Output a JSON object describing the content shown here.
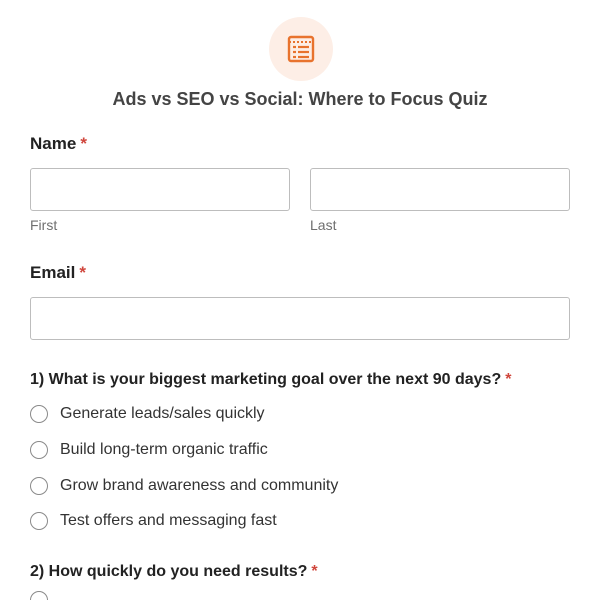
{
  "header": {
    "icon": "form-list-icon",
    "accent_color": "#e8732e",
    "icon_bg_color": "#fdeee6"
  },
  "form": {
    "title": "Ads vs SEO vs Social: Where to Focus Quiz",
    "required_marker": "*",
    "name": {
      "label": "Name",
      "first_value": "",
      "last_value": "",
      "first_sublabel": "First",
      "last_sublabel": "Last"
    },
    "email": {
      "label": "Email",
      "value": ""
    },
    "questions": [
      {
        "text": "1) What is your biggest marketing goal over the next 90 days?",
        "options": [
          "Generate leads/sales quickly",
          "Build long-term organic traffic",
          "Grow brand awareness and community",
          "Test offers and messaging fast"
        ]
      },
      {
        "text": "2) How quickly do you need results?",
        "options": []
      }
    ]
  }
}
